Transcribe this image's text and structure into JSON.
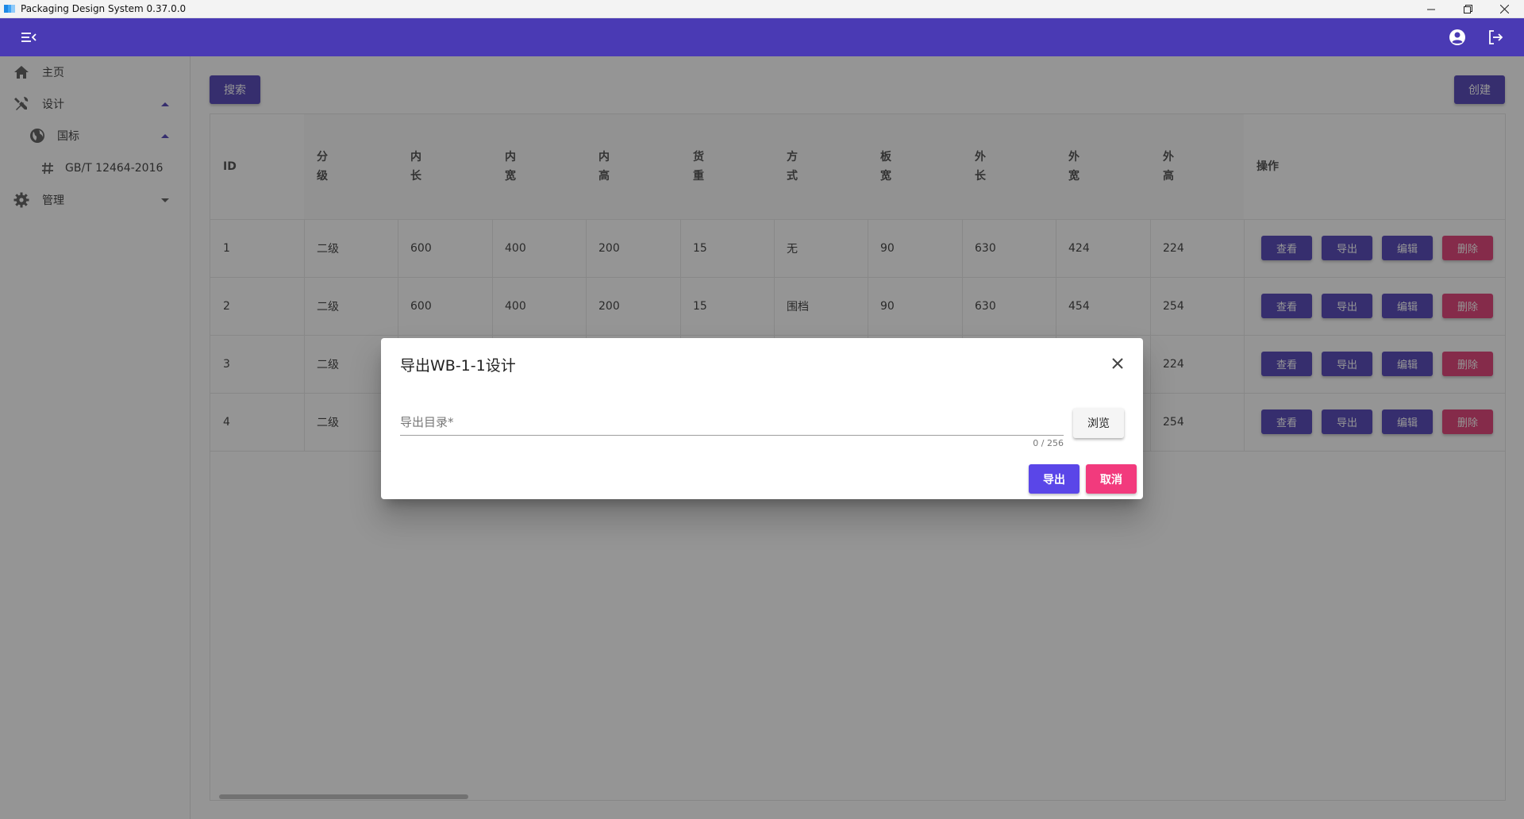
{
  "window": {
    "title": "Packaging Design System 0.37.0.0"
  },
  "sidebar": {
    "items": [
      {
        "label": "主页"
      },
      {
        "label": "设计"
      },
      {
        "label": "国标"
      },
      {
        "label": "GB/T 12464-2016"
      },
      {
        "label": "管理"
      }
    ]
  },
  "toolbar": {
    "search_label": "搜索",
    "create_label": "创建"
  },
  "table": {
    "columns": [
      "ID",
      "分级",
      "内长",
      "内宽",
      "内高",
      "货重",
      "方式",
      "板宽",
      "外长",
      "外宽",
      "外高",
      "操作"
    ],
    "column_lines": [
      [
        "ID"
      ],
      [
        "分",
        "级"
      ],
      [
        "内",
        "长"
      ],
      [
        "内",
        "宽"
      ],
      [
        "内",
        "高"
      ],
      [
        "货",
        "重"
      ],
      [
        "方",
        "式"
      ],
      [
        "板",
        "宽"
      ],
      [
        "外",
        "长"
      ],
      [
        "外",
        "宽"
      ],
      [
        "外",
        "高"
      ],
      [
        "操作"
      ]
    ],
    "rows": [
      [
        "1",
        "二级",
        "600",
        "400",
        "200",
        "15",
        "无",
        "90",
        "630",
        "424",
        "224"
      ],
      [
        "2",
        "二级",
        "600",
        "400",
        "200",
        "15",
        "围档",
        "90",
        "630",
        "454",
        "254"
      ],
      [
        "3",
        "二级",
        "",
        "",
        "",
        "",
        "",
        "",
        "",
        "",
        "224"
      ],
      [
        "4",
        "二级",
        "",
        "",
        "",
        "",
        "",
        "",
        "",
        "",
        "254"
      ]
    ],
    "row_actions": [
      "查看",
      "导出",
      "编辑",
      "删除"
    ]
  },
  "dialog": {
    "title": "导出WB-1-1设计",
    "field_placeholder": "导出目录*",
    "field_value": "",
    "counter": "0 / 256",
    "browse_label": "浏览",
    "confirm_label": "导出",
    "cancel_label": "取消"
  },
  "colors": {
    "primary": "#4a3ab4",
    "danger": "#e0356f",
    "dialog_primary": "#5a46e8",
    "dialog_danger": "#f23a7d"
  }
}
